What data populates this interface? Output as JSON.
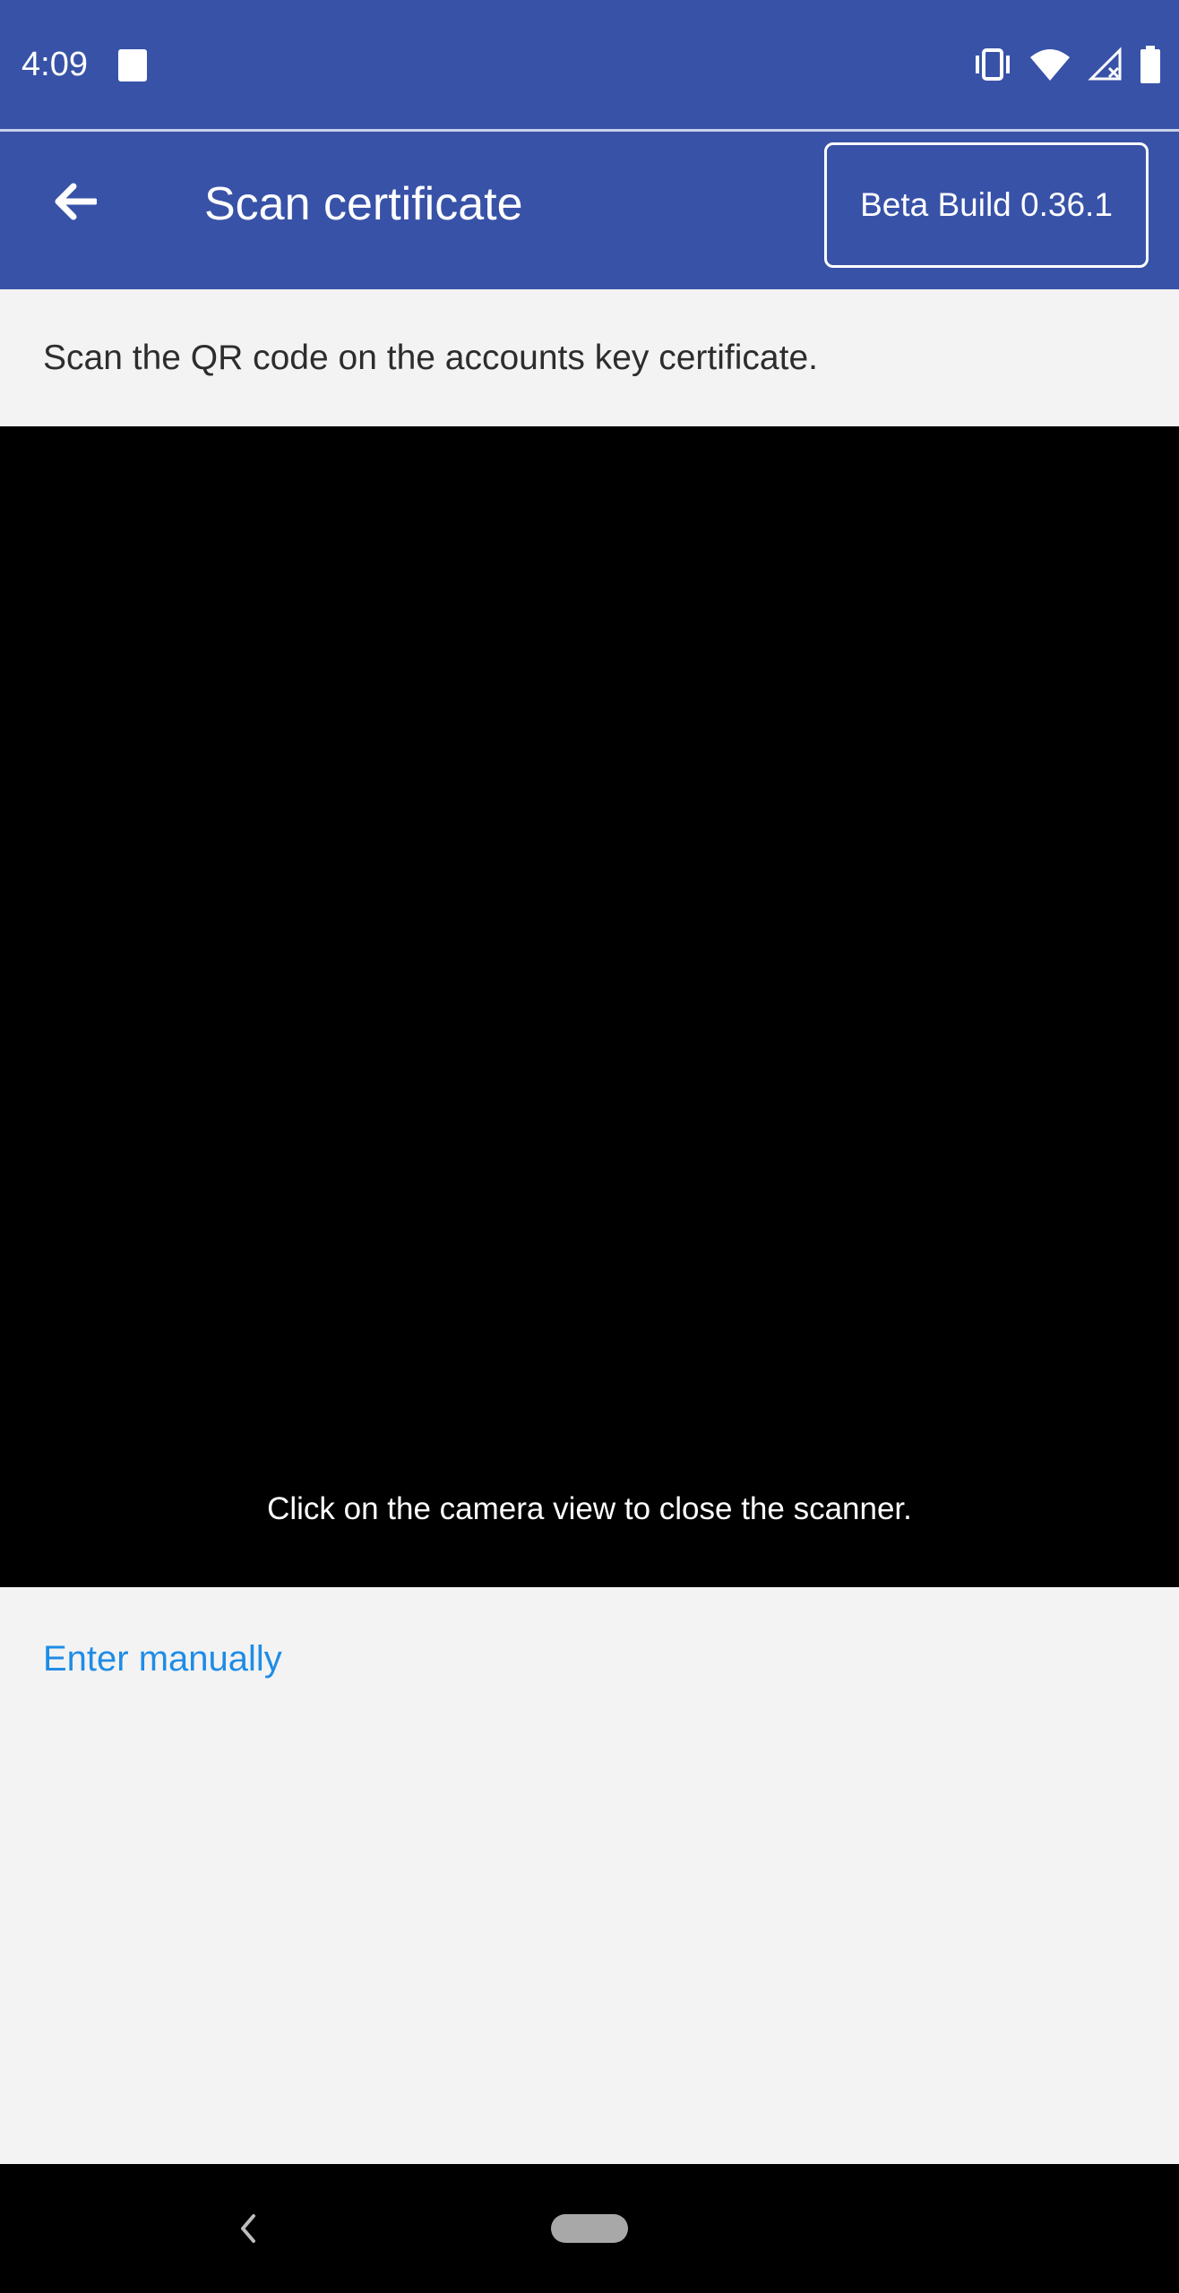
{
  "status_bar": {
    "time": "4:09",
    "icons": [
      "notification-square-icon",
      "vibrate-icon",
      "wifi-icon",
      "no-signal-icon",
      "battery-icon"
    ]
  },
  "app_bar": {
    "title": "Scan certificate",
    "back_icon": "arrow-left-icon",
    "beta_label": "Beta Build 0.36.1",
    "background": "#3852a7"
  },
  "content": {
    "instruction": "Scan the QR code on the accounts key certificate.",
    "camera_hint": "Click on the camera view to close the scanner.",
    "enter_manually": "Enter manually",
    "link_color": "#1f8ce6"
  },
  "nav_bar": {
    "icons": [
      "nav-back-icon",
      "nav-home-pill"
    ]
  }
}
